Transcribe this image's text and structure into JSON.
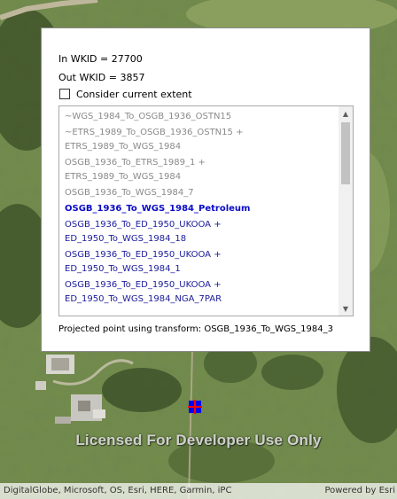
{
  "panel": {
    "in_wkid": "In WKID = 27700",
    "out_wkid": "Out WKID = 3857",
    "checkbox_label": "Consider current extent",
    "checkbox_checked": false,
    "transforms": [
      {
        "text": "~WGS_1984_To_OSGB_1936_OSTN15",
        "state": "unavailable"
      },
      {
        "text": "~ETRS_1989_To_OSGB_1936_OSTN15 +\nETRS_1989_To_WGS_1984",
        "state": "unavailable"
      },
      {
        "text": "OSGB_1936_To_ETRS_1989_1 +\nETRS_1989_To_WGS_1984",
        "state": "unavailable"
      },
      {
        "text": "OSGB_1936_To_WGS_1984_7",
        "state": "unavailable"
      },
      {
        "text": "OSGB_1936_To_WGS_1984_Petroleum",
        "state": "selected"
      },
      {
        "text": "OSGB_1936_To_ED_1950_UKOOA +\nED_1950_To_WGS_1984_18",
        "state": "available"
      },
      {
        "text": "OSGB_1936_To_ED_1950_UKOOA +\nED_1950_To_WGS_1984_1",
        "state": "available"
      },
      {
        "text": "OSGB_1936_To_ED_1950_UKOOA +\nED_1950_To_WGS_1984_NGA_7PAR",
        "state": "available"
      }
    ],
    "projected_text": "Projected point using transform: OSGB_1936_To_WGS_1984_3"
  },
  "map": {
    "watermark": "Licensed For Developer Use Only",
    "attribution": "DigitalGlobe, Microsoft, OS, Esri, HERE, Garmin, iPC",
    "powered_by": "Powered by Esri"
  },
  "colors": {
    "unavailable": "#8a8a8a",
    "available": "#1a1a9c",
    "selected": "#0a0ac8",
    "marker_fill": "#0000ff",
    "marker_cross": "#ff0000"
  },
  "icons": {
    "scroll_up": "chevron-up-icon",
    "scroll_down": "chevron-down-icon"
  }
}
